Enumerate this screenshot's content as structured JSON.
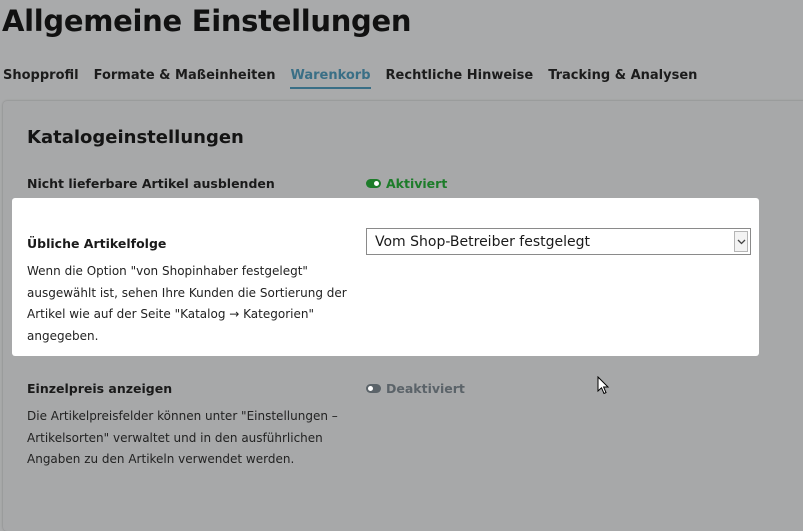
{
  "page": {
    "title": "Allgemeine Einstellungen"
  },
  "tabs": [
    {
      "label": "Shopprofil",
      "active": false
    },
    {
      "label": "Formate & Maßeinheiten",
      "active": false
    },
    {
      "label": "Warenkorb",
      "active": true
    },
    {
      "label": "Rechtliche Hinweise",
      "active": false
    },
    {
      "label": "Tracking & Analysen",
      "active": false
    }
  ],
  "section": {
    "title": "Katalogeinstellungen"
  },
  "settings": {
    "hide_unavailable": {
      "label": "Nicht lieferbare Artikel ausblenden",
      "status": "Aktiviert"
    },
    "sort_order": {
      "label": "Übliche Artikelfolge",
      "selected": "Vom Shop-Betreiber festgelegt",
      "desc_lines": [
        "Wenn die Option \"von Shopinhaber festgelegt\"",
        "ausgewählt ist, sehen Ihre Kunden die Sortierung der",
        "Artikel wie auf der Seite \"Katalog → Kategorien\"",
        "angegeben."
      ]
    },
    "unit_price": {
      "label": "Einzelpreis anzeigen",
      "status": "Deaktiviert",
      "desc_lines": [
        "Die Artikelpreisfelder können unter \"Einstellungen –",
        "Artikelsorten\" verwaltet und in den ausführlichen",
        "Angaben zu den Artikeln verwendet werden."
      ]
    }
  },
  "colors": {
    "accent": "#3a6f86",
    "enabled": "#1d7c2a",
    "disabled": "#5b6369"
  }
}
